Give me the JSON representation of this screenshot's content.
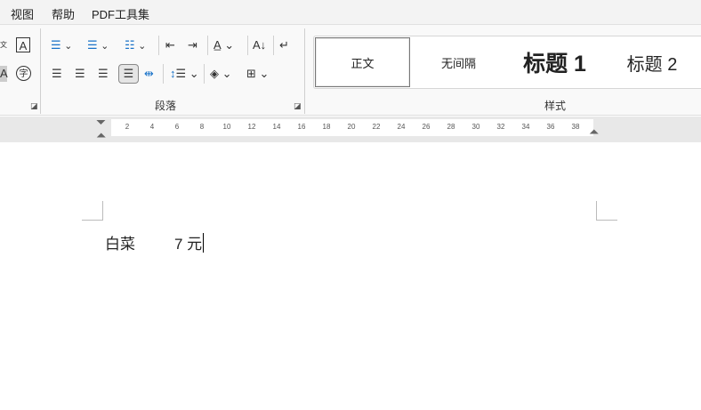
{
  "menu": [
    "视图",
    "帮助",
    "PDF工具集"
  ],
  "ribbon": {
    "paragraph_label": "段落",
    "styles_label": "样式"
  },
  "styles": [
    "正文",
    "无间隔",
    "标题 1",
    "标题 2"
  ],
  "ruler": [
    "2",
    "4",
    "6",
    "8",
    "10",
    "12",
    "14",
    "16",
    "18",
    "20",
    "22",
    "24",
    "26",
    "28",
    "30",
    "32",
    "34",
    "36",
    "38"
  ],
  "document": {
    "item": "白菜",
    "price": "7 元"
  }
}
